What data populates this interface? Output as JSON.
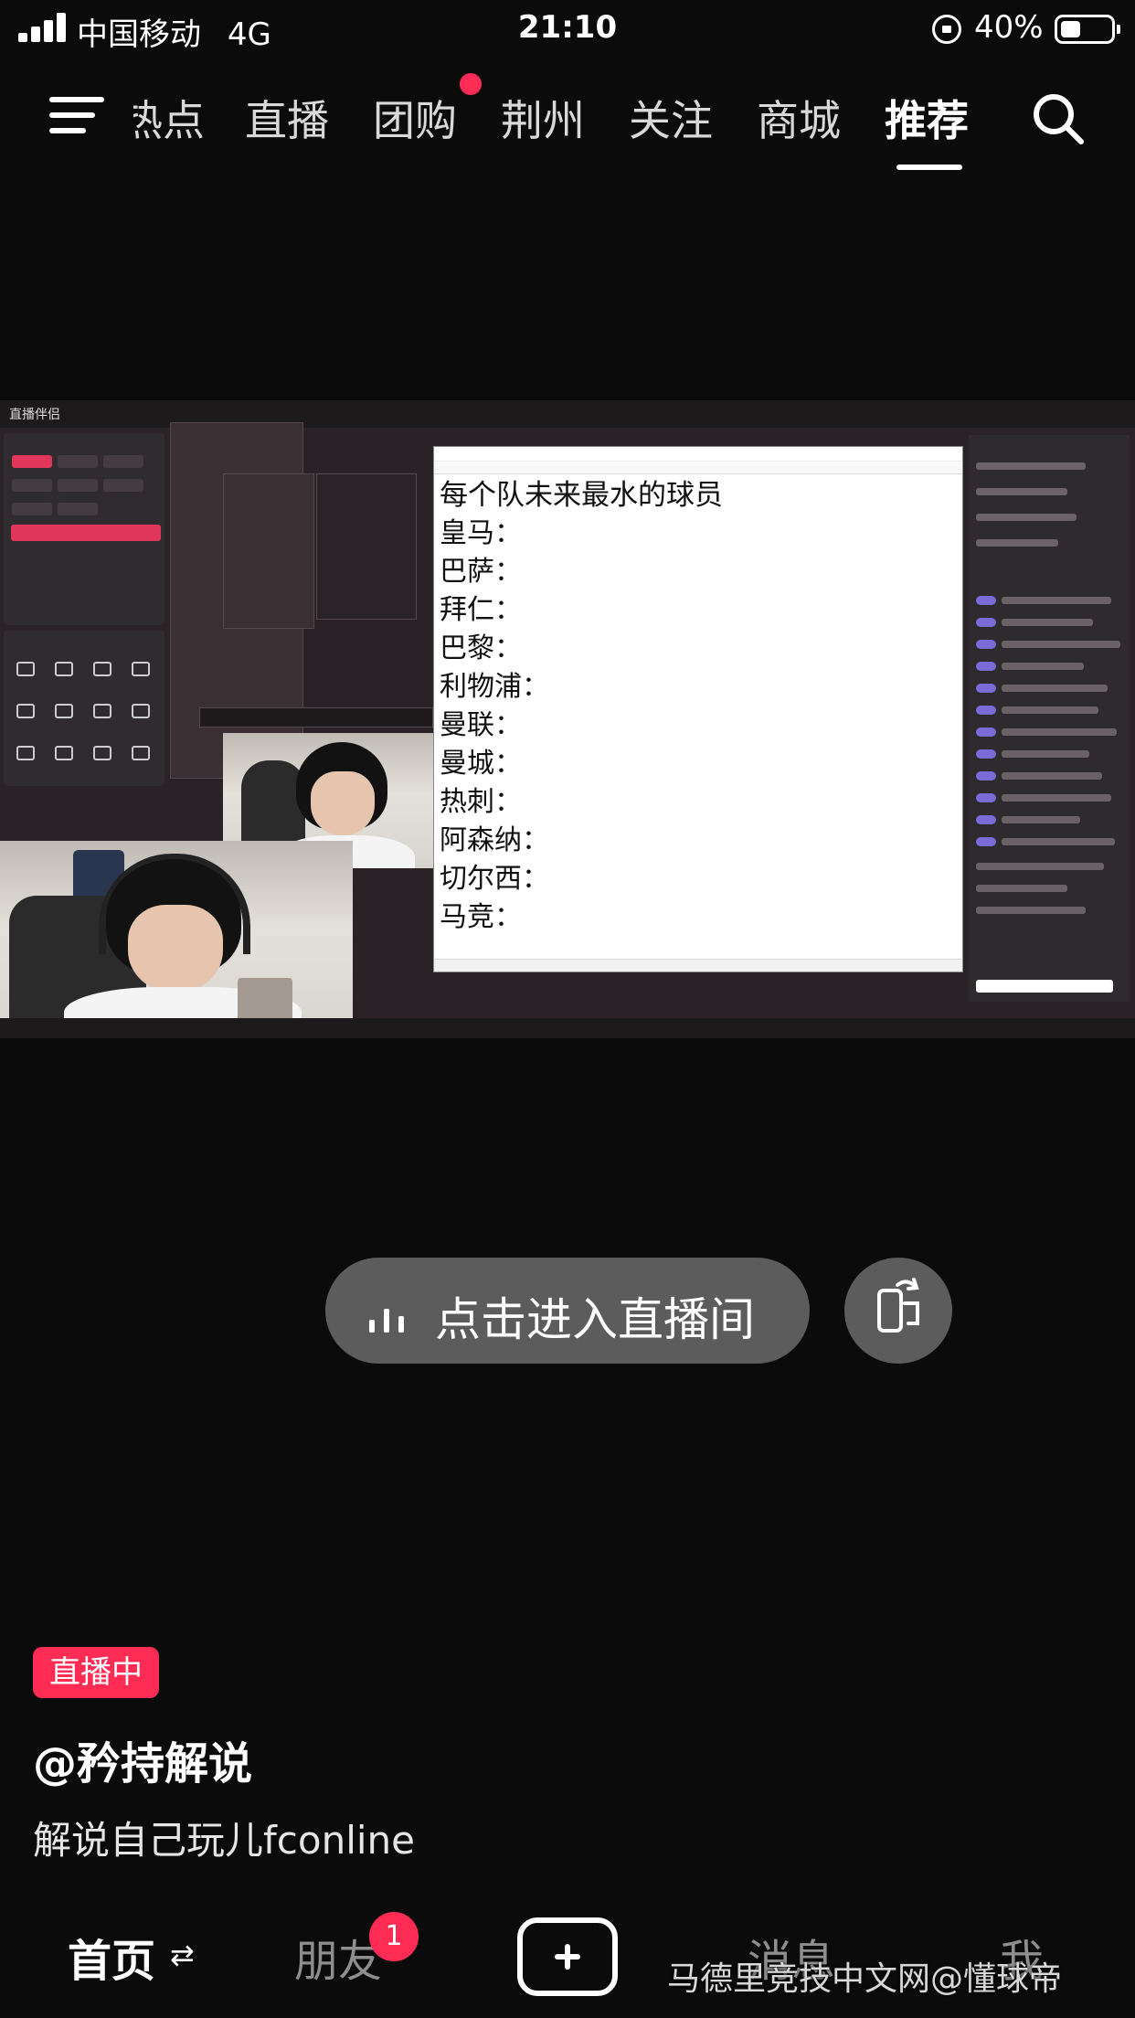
{
  "status_bar": {
    "carrier": "中国移动",
    "network": "4G",
    "time": "21:10",
    "battery_percent": "40%",
    "battery_level": 0.4,
    "icons": [
      "signal-icon",
      "rotation-lock-icon",
      "battery-icon"
    ]
  },
  "top_nav": {
    "tabs": [
      {
        "label": "热点",
        "visible_text": "热点"
      },
      {
        "label": "直播"
      },
      {
        "label": "团购",
        "has_red_dot": true
      },
      {
        "label": "荆州"
      },
      {
        "label": "关注"
      },
      {
        "label": "商城"
      },
      {
        "label": "推荐",
        "active": true
      }
    ],
    "icons": [
      "menu-icon",
      "search-icon"
    ]
  },
  "stream": {
    "app_title": "直播伴侣",
    "notepad_lines": [
      "每个队未来最水的球员",
      "皇马：",
      "巴萨：",
      "拜仁：",
      "巴黎：",
      "利物浦：",
      "曼联：",
      "曼城：",
      "热刺：",
      "阿森纳：",
      "切尔西：",
      "马竞："
    ]
  },
  "enter_live": {
    "label": "点击进入直播间",
    "icons": [
      "live-bars-icon",
      "rotate-screen-icon"
    ]
  },
  "live_info": {
    "badge": "直播中",
    "anchor": "@矜持解说",
    "title": "解说自己玩儿fconline"
  },
  "bottom_bar": {
    "home": "首页",
    "friends": "朋友",
    "friends_badge": "1",
    "messages": "消息",
    "me": "我"
  },
  "watermark": "马德里竞技中文网@懂球帝",
  "colors": {
    "accent": "#fe2c55",
    "background": "#0b0b0c"
  }
}
